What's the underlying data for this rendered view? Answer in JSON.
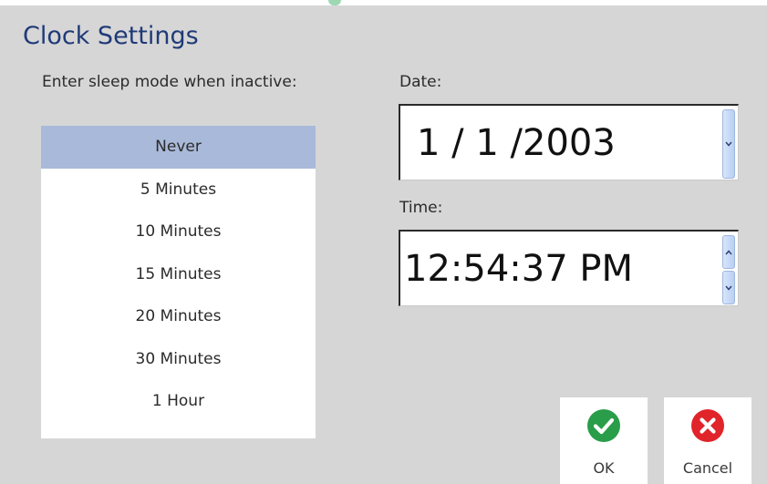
{
  "dialog": {
    "title": "Clock Settings"
  },
  "sleep": {
    "label": "Enter sleep mode when inactive:",
    "selected": "Never",
    "options": [
      {
        "label": "Never",
        "selected": true
      },
      {
        "label": "5 Minutes",
        "selected": false
      },
      {
        "label": "10 Minutes",
        "selected": false
      },
      {
        "label": "15 Minutes",
        "selected": false
      },
      {
        "label": "20 Minutes",
        "selected": false
      },
      {
        "label": "30 Minutes",
        "selected": false
      },
      {
        "label": "1 Hour",
        "selected": false
      }
    ]
  },
  "date": {
    "label": "Date:",
    "value": "1 / 1 /2003",
    "down_icon": "chevron-down-icon"
  },
  "time": {
    "label": "Time:",
    "value": "12:54:37 PM",
    "up_icon": "chevron-up-icon",
    "down_icon": "chevron-down-icon"
  },
  "buttons": {
    "ok_label": "OK",
    "ok_icon": "checkmark-icon",
    "cancel_label": "Cancel",
    "cancel_icon": "close-icon"
  },
  "colors": {
    "title": "#1f3a78",
    "background": "#d6d6d6",
    "selected_item": "#a9b9d9",
    "ok_green": "#2a9d4a",
    "cancel_red": "#e0242a"
  }
}
